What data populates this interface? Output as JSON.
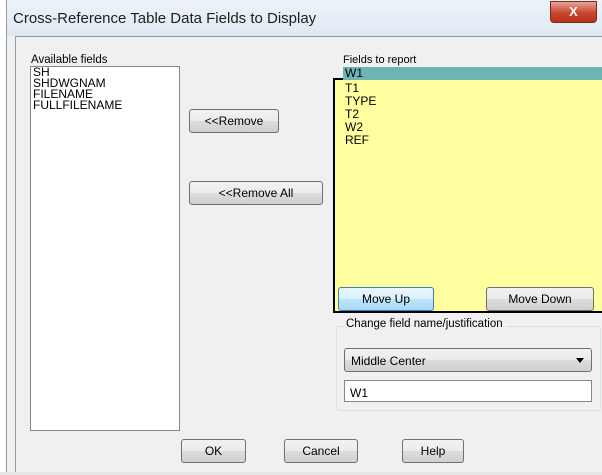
{
  "window": {
    "title": "Cross-Reference Table Data Fields to Display",
    "close_glyph": "X"
  },
  "available_fields": {
    "label": "Available fields",
    "items": [
      "SH",
      "SHDWGNAM",
      "FILENAME",
      "FULLFILENAME"
    ]
  },
  "buttons": {
    "remove": "<<Remove",
    "remove_all": "<<Remove All",
    "move_up": "Move Up",
    "move_down": "Move Down",
    "ok": "OK",
    "cancel": "Cancel",
    "help": "Help"
  },
  "fields_to_report": {
    "label": "Fields to report",
    "items": [
      "W1",
      "T1",
      "TYPE",
      "T2",
      "W2",
      "REF"
    ],
    "selected": "W1",
    "background_color": "#ffffa0",
    "selection_color": "#6fb4b4"
  },
  "change_field": {
    "group_label": "Change field name/justification",
    "justification_value": "Middle Center",
    "name_value": "W1"
  },
  "icons": {
    "close": "close-icon",
    "dropdown": "chevron-down-icon"
  }
}
